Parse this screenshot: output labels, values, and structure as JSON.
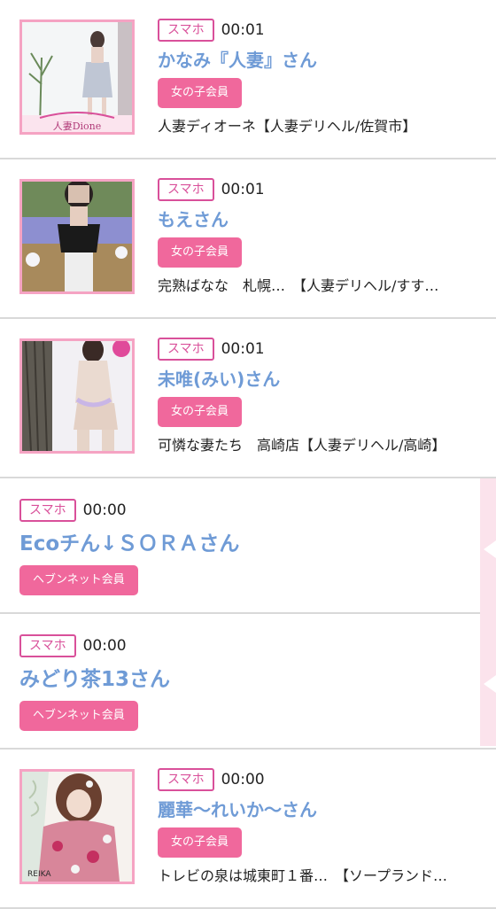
{
  "entries": [
    {
      "device": "スマホ",
      "time": "00:01",
      "name": "かなみ『人妻』さん",
      "badge": "女の子会員",
      "shop": "人妻ディオーネ【人妻デリヘル/佐賀市】",
      "thumb_caption": "人妻Dione"
    },
    {
      "device": "スマホ",
      "time": "00:01",
      "name": "もえさん",
      "badge": "女の子会員",
      "shop": "完熟ばなな　札幌…　【人妻デリヘル/すす…"
    },
    {
      "device": "スマホ",
      "time": "00:01",
      "name": "未唯(みい)さん",
      "badge": "女の子会員",
      "shop": "可憐な妻たち　高崎店【人妻デリヘル/高崎】"
    },
    {
      "device": "スマホ",
      "time": "00:00",
      "name": "Ecoチん↓ＳＯＲＡさん",
      "badge": "ヘブンネット会員"
    },
    {
      "device": "スマホ",
      "time": "00:00",
      "name": "みどり茶13さん",
      "badge": "ヘブンネット会員"
    },
    {
      "device": "スマホ",
      "time": "00:00",
      "name": "麗華〜れいか〜さん",
      "badge": "女の子会員",
      "shop": "トレビの泉は城東町１番…　【ソープランド…",
      "thumb_caption": "REIKA"
    }
  ],
  "colors": {
    "accent_pink": "#f0689c",
    "tag_pink": "#d9509a",
    "name_blue": "#6f9bd6",
    "divider": "#d9d9d9",
    "side_tab": "#fbe3ec"
  },
  "icons": {
    "side_tab": "left-pointing-notch"
  }
}
